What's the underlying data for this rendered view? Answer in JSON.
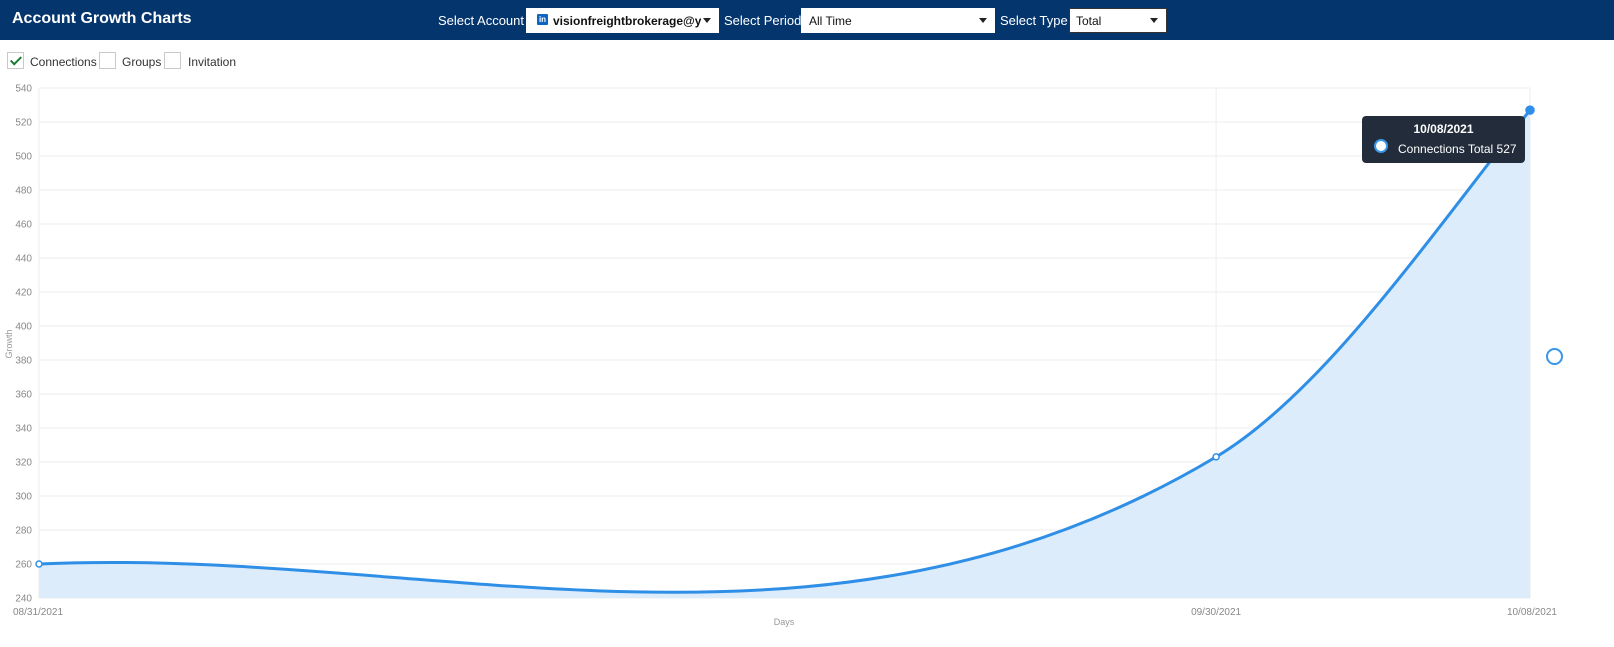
{
  "header": {
    "title": "Account Growth Charts",
    "select_account_label": "Select Account",
    "account_value": "visionfreightbrokerage@y",
    "account_icon": "linkedin-icon",
    "account_icon_text": "in",
    "select_period_label": "Select Period",
    "period_value": "All Time",
    "select_type_label": "Select Type",
    "type_value": "Total"
  },
  "filters": [
    {
      "label": "Connections",
      "checked": true
    },
    {
      "label": "Groups",
      "checked": false
    },
    {
      "label": "Invitation",
      "checked": false
    }
  ],
  "colors": {
    "header_bg": "#04366d",
    "series_line": "#2f8fe6",
    "series_fill": "#dcecfb",
    "check": "#1b7a35"
  },
  "tooltip": {
    "date": "10/08/2021",
    "label": "Connections Total",
    "value": "527"
  },
  "chart_data": {
    "type": "area",
    "ylabel": "Growth",
    "xlabel": "Days",
    "ylim": [
      240,
      540
    ],
    "yticks": [
      240,
      260,
      280,
      300,
      320,
      340,
      360,
      380,
      400,
      420,
      440,
      460,
      480,
      500,
      520,
      540
    ],
    "x": [
      "08/31/2021",
      "09/30/2021",
      "10/08/2021"
    ],
    "series": [
      {
        "name": "Connections Total",
        "values": [
          260,
          323,
          527
        ]
      }
    ],
    "grid": true
  }
}
